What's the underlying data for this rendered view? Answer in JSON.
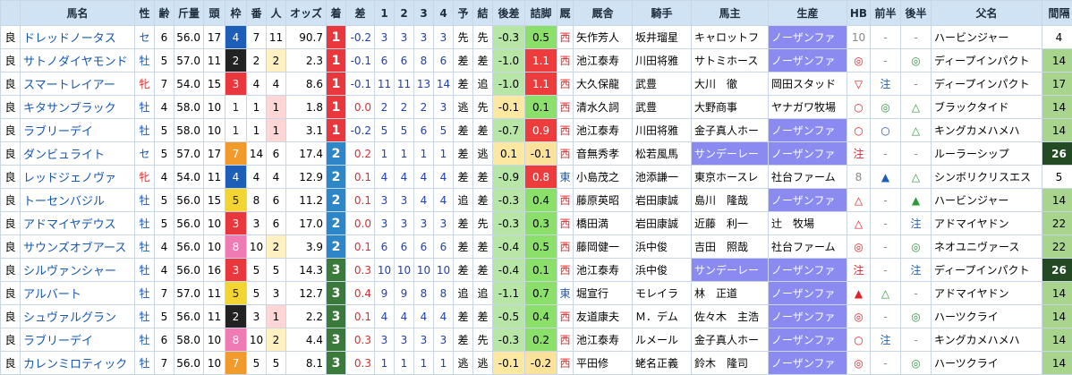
{
  "headers": [
    "",
    "馬名",
    "性",
    "齢",
    "斤量",
    "頭",
    "枠",
    "番",
    "人",
    "オッズ",
    "着",
    "差",
    "1",
    "2",
    "3",
    "4",
    "予",
    "結",
    "後差",
    "詰脚",
    "厩",
    "厩舎",
    "騎手",
    "馬主",
    "生産",
    "HB",
    "前半",
    "後半",
    "父名",
    "間隔"
  ],
  "rows": [
    {
      "cond": "良",
      "name": "ドレッドノータス",
      "sex": "セ",
      "age": "6",
      "wt": "56.0",
      "runners": "17",
      "waku": "4",
      "ban": "7",
      "pop": "11",
      "odds": "90.7",
      "fin": "1",
      "diff": "-0.2",
      "c1": "3",
      "c2": "3",
      "c3": "3",
      "c4": "3",
      "pre": "先",
      "res": "先",
      "late": "-0.3",
      "close": "0.5",
      "stable": "西",
      "trainer": "矢作芳人",
      "jockey": "坂井瑠星",
      "owner": "キャロットフ",
      "breeder": "ノーザンファ",
      "hb": "10",
      "first": "-",
      "second": "-",
      "sire": "ハービンジャー",
      "gap": "4"
    },
    {
      "cond": "良",
      "name": "サトノダイヤモンド",
      "sex": "牡",
      "age": "5",
      "wt": "57.0",
      "runners": "11",
      "waku": "2",
      "ban": "2",
      "pop": "2",
      "odds": "2.3",
      "fin": "1",
      "diff": "-0.1",
      "c1": "6",
      "c2": "6",
      "c3": "8",
      "c4": "6",
      "pre": "差",
      "res": "差",
      "late": "-1.0",
      "close": "1.1",
      "stable": "西",
      "trainer": "池江泰寿",
      "jockey": "川田将雅",
      "owner": "サトミホース",
      "breeder": "ノーザンファ",
      "hb": "◎",
      "first": "-",
      "second": "◎",
      "sire": "ディープインパクト",
      "gap": "14"
    },
    {
      "cond": "良",
      "name": "スマートレイアー",
      "sex": "牝",
      "age": "7",
      "wt": "54.0",
      "runners": "15",
      "waku": "3",
      "ban": "4",
      "pop": "4",
      "odds": "8.6",
      "fin": "1",
      "diff": "-0.1",
      "c1": "11",
      "c2": "11",
      "c3": "13",
      "c4": "14",
      "pre": "差",
      "res": "追",
      "late": "-1.0",
      "close": "1.1",
      "stable": "西",
      "trainer": "大久保龍",
      "jockey": "武豊",
      "owner": "大川　徹",
      "breeder": "岡田スタッド",
      "hb": "▽",
      "first": "注",
      "second": "-",
      "sire": "ディープインパクト",
      "gap": "17"
    },
    {
      "cond": "良",
      "name": "キタサンブラック",
      "sex": "牡",
      "age": "4",
      "wt": "58.0",
      "runners": "10",
      "waku": "1",
      "ban": "1",
      "pop": "1",
      "odds": "1.8",
      "fin": "1",
      "diff": "0.0",
      "c1": "2",
      "c2": "2",
      "c3": "2",
      "c4": "3",
      "pre": "逃",
      "res": "先",
      "late": "-0.1",
      "close": "0.1",
      "stable": "西",
      "trainer": "清水久詞",
      "jockey": "武豊",
      "owner": "大野商事",
      "breeder": "ヤナガワ牧場",
      "hb": "○",
      "first": "◎",
      "second": "△",
      "sire": "ブラックタイド",
      "gap": "14"
    },
    {
      "cond": "良",
      "name": "ラブリーデイ",
      "sex": "牡",
      "age": "5",
      "wt": "58.0",
      "runners": "10",
      "waku": "1",
      "ban": "1",
      "pop": "1",
      "odds": "3.1",
      "fin": "1",
      "diff": "-0.2",
      "c1": "5",
      "c2": "5",
      "c3": "6",
      "c4": "5",
      "pre": "差",
      "res": "差",
      "late": "-0.7",
      "close": "0.9",
      "stable": "西",
      "trainer": "池江泰寿",
      "jockey": "川田将雅",
      "owner": "金子真人ホー",
      "breeder": "ノーザンファ",
      "hb": "○",
      "first": "○",
      "second": "△",
      "sire": "キングカメハメハ",
      "gap": "14"
    },
    {
      "cond": "良",
      "name": "ダンビュライト",
      "sex": "セ",
      "age": "5",
      "wt": "57.0",
      "runners": "17",
      "waku": "7",
      "ban": "14",
      "pop": "6",
      "odds": "17.4",
      "fin": "2",
      "diff": "0.2",
      "c1": "1",
      "c2": "1",
      "c3": "1",
      "c4": "1",
      "pre": "差",
      "res": "逃",
      "late": "0.1",
      "close": "-0.1",
      "stable": "西",
      "trainer": "音無秀孝",
      "jockey": "松若風馬",
      "owner": "サンデーレー",
      "breeder": "ノーザンファ",
      "hb": "注",
      "first": "-",
      "second": "-",
      "sire": "ルーラーシップ",
      "gap": "26"
    },
    {
      "cond": "良",
      "name": "レッドジェノヴァ",
      "sex": "牝",
      "age": "4",
      "wt": "54.0",
      "runners": "11",
      "waku": "4",
      "ban": "4",
      "pop": "4",
      "odds": "12.9",
      "fin": "2",
      "diff": "0.1",
      "c1": "4",
      "c2": "4",
      "c3": "4",
      "c4": "4",
      "pre": "差",
      "res": "差",
      "late": "-0.9",
      "close": "0.8",
      "stable": "東",
      "trainer": "小島茂之",
      "jockey": "池添謙一",
      "owner": "東京ホースレ",
      "breeder": "社台ファーム",
      "hb": "8",
      "first": "▲",
      "second": "△",
      "sire": "シンボリクリスエス",
      "gap": "5"
    },
    {
      "cond": "良",
      "name": "トーセンバジル",
      "sex": "牡",
      "age": "5",
      "wt": "56.0",
      "runners": "15",
      "waku": "5",
      "ban": "8",
      "pop": "6",
      "odds": "11.2",
      "fin": "2",
      "diff": "0.1",
      "c1": "3",
      "c2": "3",
      "c3": "4",
      "c4": "4",
      "pre": "追",
      "res": "差",
      "late": "-0.3",
      "close": "0.4",
      "stable": "西",
      "trainer": "藤原英昭",
      "jockey": "岩田康誠",
      "owner": "島川　隆哉",
      "breeder": "ノーザンファ",
      "hb": "△",
      "first": "-",
      "second": "▲",
      "sire": "ハービンジャー",
      "gap": "14"
    },
    {
      "cond": "良",
      "name": "アドマイヤデウス",
      "sex": "牡",
      "age": "5",
      "wt": "56.0",
      "runners": "10",
      "waku": "3",
      "ban": "3",
      "pop": "6",
      "odds": "17.0",
      "fin": "2",
      "diff": "0.0",
      "c1": "3",
      "c2": "3",
      "c3": "3",
      "c4": "3",
      "pre": "差",
      "res": "先",
      "late": "-0.3",
      "close": "0.3",
      "stable": "西",
      "trainer": "橋田満",
      "jockey": "岩田康誠",
      "owner": "近藤　利一",
      "breeder": "辻　牧場",
      "hb": "△",
      "first": "-",
      "second": "注",
      "sire": "アドマイヤドン",
      "gap": "22"
    },
    {
      "cond": "良",
      "name": "サウンズオブアース",
      "sex": "牡",
      "age": "4",
      "wt": "56.0",
      "runners": "10",
      "waku": "8",
      "ban": "10",
      "pop": "2",
      "odds": "3.9",
      "fin": "2",
      "diff": "0.1",
      "c1": "6",
      "c2": "6",
      "c3": "6",
      "c4": "6",
      "pre": "差",
      "res": "差",
      "late": "-0.4",
      "close": "0.5",
      "stable": "西",
      "trainer": "藤岡健一",
      "jockey": "浜中俊",
      "owner": "吉田　照哉",
      "breeder": "社台ファーム",
      "hb": "◎",
      "first": "-",
      "second": "◎",
      "sire": "ネオユニヴァース",
      "gap": "22"
    },
    {
      "cond": "良",
      "name": "シルヴァンシャー",
      "sex": "牡",
      "age": "4",
      "wt": "56.0",
      "runners": "16",
      "waku": "3",
      "ban": "5",
      "pop": "5",
      "odds": "14.3",
      "fin": "3",
      "diff": "0.3",
      "c1": "10",
      "c2": "10",
      "c3": "10",
      "c4": "10",
      "pre": "差",
      "res": "差",
      "late": "-0.4",
      "close": "0.1",
      "stable": "西",
      "trainer": "池江泰寿",
      "jockey": "浜中俊",
      "owner": "サンデーレー",
      "breeder": "ノーザンファ",
      "hb": "注",
      "first": "-",
      "second": "注",
      "sire": "ディープインパクト",
      "gap": "26"
    },
    {
      "cond": "良",
      "name": "アルバート",
      "sex": "牡",
      "age": "7",
      "wt": "57.0",
      "runners": "11",
      "waku": "5",
      "ban": "5",
      "pop": "3",
      "odds": "12.7",
      "fin": "3",
      "diff": "0.4",
      "c1": "9",
      "c2": "9",
      "c3": "8",
      "c4": "8",
      "pre": "追",
      "res": "追",
      "late": "-1.1",
      "close": "0.7",
      "stable": "東",
      "trainer": "堀宣行",
      "jockey": "モレイラ",
      "owner": "林　正道",
      "breeder": "ノーザンファ",
      "hb": "▲",
      "first": "△",
      "second": "-",
      "sire": "アドマイヤドン",
      "gap": "14"
    },
    {
      "cond": "良",
      "name": "シュヴァルグラン",
      "sex": "牡",
      "age": "5",
      "wt": "56.0",
      "runners": "11",
      "waku": "2",
      "ban": "3",
      "pop": "1",
      "odds": "2.2",
      "fin": "3",
      "diff": "0.1",
      "c1": "4",
      "c2": "4",
      "c3": "4",
      "c4": "4",
      "pre": "差",
      "res": "差",
      "late": "-0.5",
      "close": "0.4",
      "stable": "西",
      "trainer": "友道康夫",
      "jockey": "Ｍ．デム",
      "owner": "佐々木　主浩",
      "breeder": "ノーザンファ",
      "hb": "◎",
      "first": "-",
      "second": "◎",
      "sire": "ハーツクライ",
      "gap": "14"
    },
    {
      "cond": "良",
      "name": "ラブリーデイ",
      "sex": "牡",
      "age": "6",
      "wt": "58.0",
      "runners": "10",
      "waku": "8",
      "ban": "10",
      "pop": "2",
      "odds": "4.4",
      "fin": "3",
      "diff": "0.3",
      "c1": "3",
      "c2": "3",
      "c3": "3",
      "c4": "3",
      "pre": "差",
      "res": "先",
      "late": "-0.3",
      "close": "0.2",
      "stable": "西",
      "trainer": "池江泰寿",
      "jockey": "ルメール",
      "owner": "金子真人ホー",
      "breeder": "ノーザンファ",
      "hb": "○",
      "first": "注",
      "second": "-",
      "sire": "キングカメハメハ",
      "gap": "14"
    },
    {
      "cond": "良",
      "name": "カレンミロティック",
      "sex": "牡",
      "age": "7",
      "wt": "56.0",
      "runners": "10",
      "waku": "7",
      "ban": "5",
      "pop": "5",
      "odds": "8.1",
      "fin": "3",
      "diff": "0.3",
      "c1": "1",
      "c2": "1",
      "c3": "1",
      "c4": "1",
      "pre": "逃",
      "res": "逃",
      "late": "-0.1",
      "close": "-0.2",
      "stable": "西",
      "trainer": "平田修",
      "jockey": "蛯名正義",
      "owner": "鈴木　隆司",
      "breeder": "ノーザンファ",
      "hb": "◎",
      "first": "-",
      "second": "◎",
      "sire": "ハーツクライ",
      "gap": "14"
    }
  ]
}
